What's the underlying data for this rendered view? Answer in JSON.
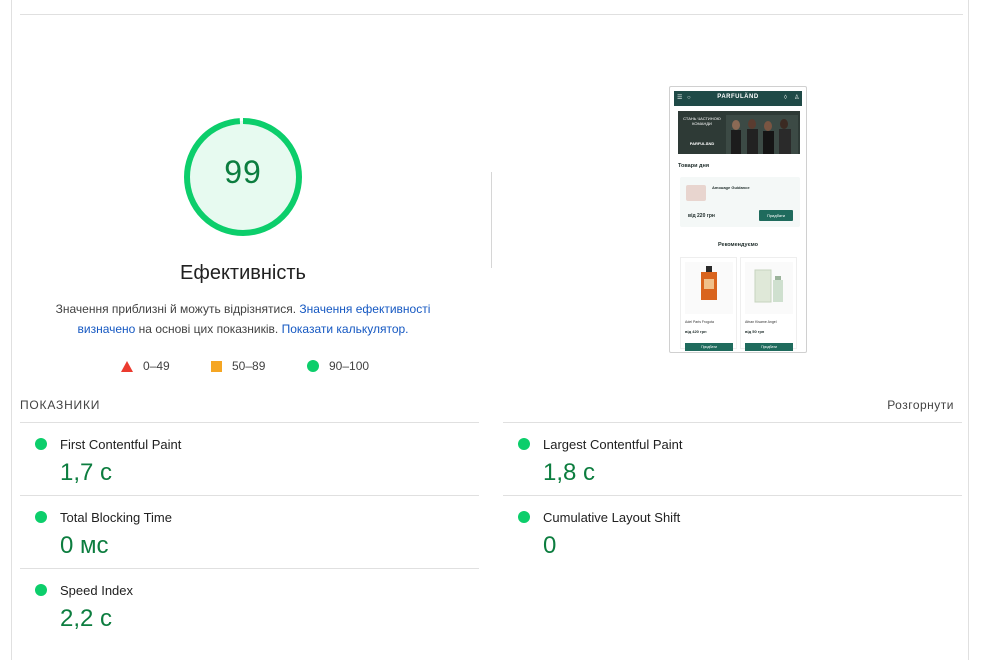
{
  "gauge": {
    "score": "99",
    "score_value": 99,
    "title": "Ефективність",
    "description_text1": "Значення приблизні й можуть відрізнятися. ",
    "description_link1": "Значення ефективності визначено",
    "description_text2": " на основі цих показників. ",
    "description_link2": "Показати калькулятор.",
    "color": "#0cce6b",
    "fill": "#e7faf0"
  },
  "legend": [
    {
      "icon": "triangle-icon",
      "label": "0–49",
      "color": "#eb3b2f"
    },
    {
      "icon": "square-icon",
      "label": "50–89",
      "color": "#f5a623"
    },
    {
      "icon": "circle-icon",
      "label": "90–100",
      "color": "#0cce6b"
    }
  ],
  "screenshot": {
    "logo": "PARFULÄND",
    "banner_text": "СТАНЬ ЧАСТИНОЮ КОМАНДИ",
    "banner_logo": "PARFULÄND",
    "section_day": "Товари дня",
    "day_product_name": "Amouage Guidance",
    "day_product_price": "від 220 грн",
    "buy_label": "Придбати",
    "section_recommended": "Рекомендуємо",
    "products": [
      {
        "name": "Adel Paris Frogota",
        "price": "від 420 грн"
      },
      {
        "name": "Afnan Kisame Angel",
        "price": "від 50 грн"
      }
    ]
  },
  "metrics": {
    "header": "ПОКАЗНИКИ",
    "toggle": "Розгорнути",
    "items": [
      {
        "name": "First Contentful Paint",
        "value": "1,7 с"
      },
      {
        "name": "Largest Contentful Paint",
        "value": "1,8 с"
      },
      {
        "name": "Total Blocking Time",
        "value": "0 мс"
      },
      {
        "name": "Cumulative Layout Shift",
        "value": "0"
      },
      {
        "name": "Speed Index",
        "value": "2,2 с"
      }
    ],
    "pass_color": "#0cce6b",
    "value_color": "#0c7d3f"
  }
}
